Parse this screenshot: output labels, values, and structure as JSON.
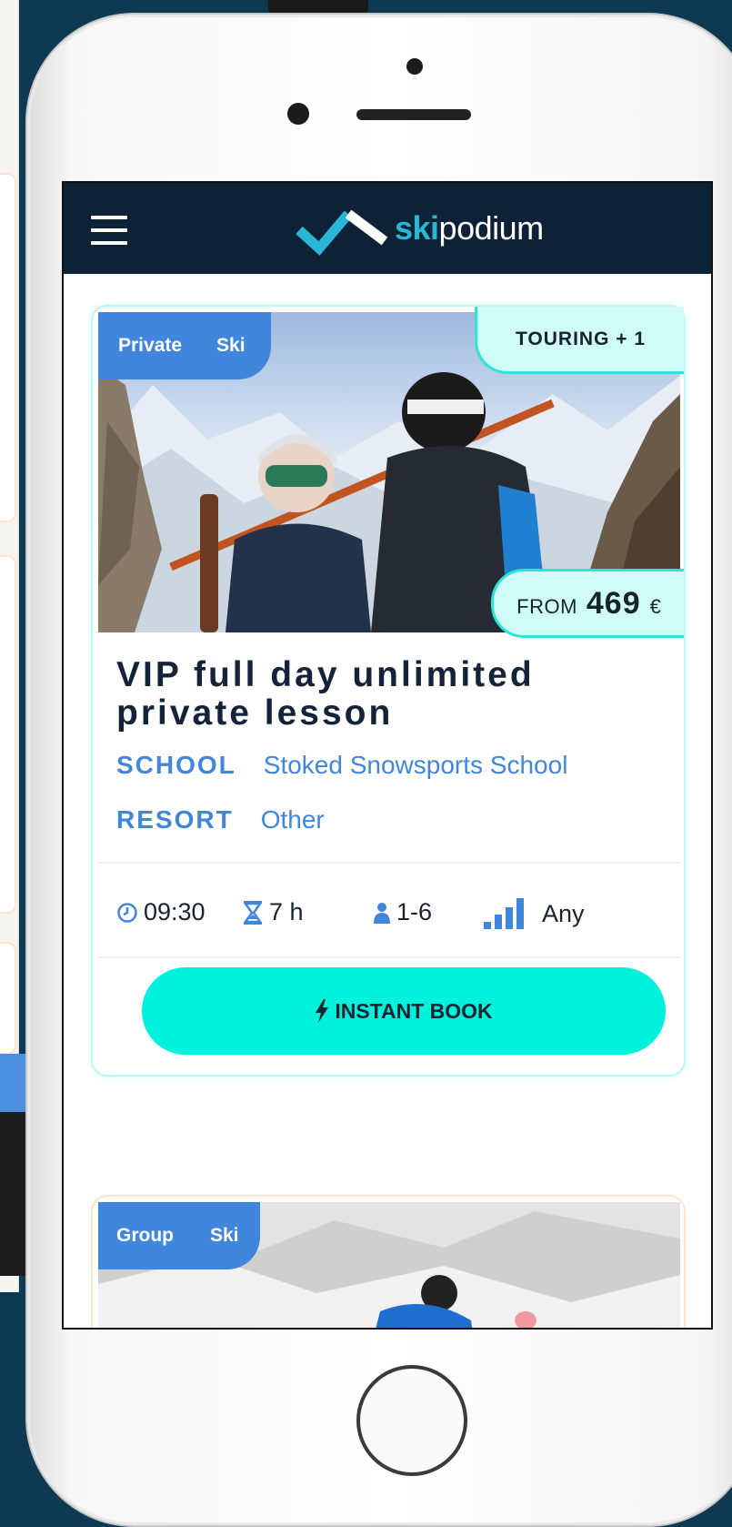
{
  "app": {
    "logo_prefix": "ski",
    "logo_suffix": "podium"
  },
  "colors": {
    "background": "#0d3a52",
    "topbar": "#0d2236",
    "accent_blue": "#3f86dc",
    "accent_cyan": "#00f2dc",
    "badge_bg": "#cffcf6",
    "title_text": "#14233a"
  },
  "icons": {
    "menu": "hamburger-icon",
    "clock": "clock-icon",
    "duration": "hourglass-icon",
    "group_size": "person-icon",
    "level": "signal-bars-icon",
    "bolt": "lightning-icon"
  },
  "cards": [
    {
      "tags": [
        "Private",
        "Ski"
      ],
      "activity_badge": "TOURING + 1",
      "price": {
        "from_label": "FROM",
        "amount": "469",
        "currency": "€"
      },
      "title": "VIP full day unlimited private lesson",
      "school_label": "SCHOOL",
      "school_value": "Stoked Snowsports School",
      "resort_label": "RESORT",
      "resort_value": "Other",
      "start_time": "09:30",
      "duration": "7 h",
      "group_size": "1-6",
      "level": "Any",
      "book_label": "INSTANT BOOK"
    },
    {
      "tags": [
        "Group",
        "Ski"
      ]
    }
  ]
}
